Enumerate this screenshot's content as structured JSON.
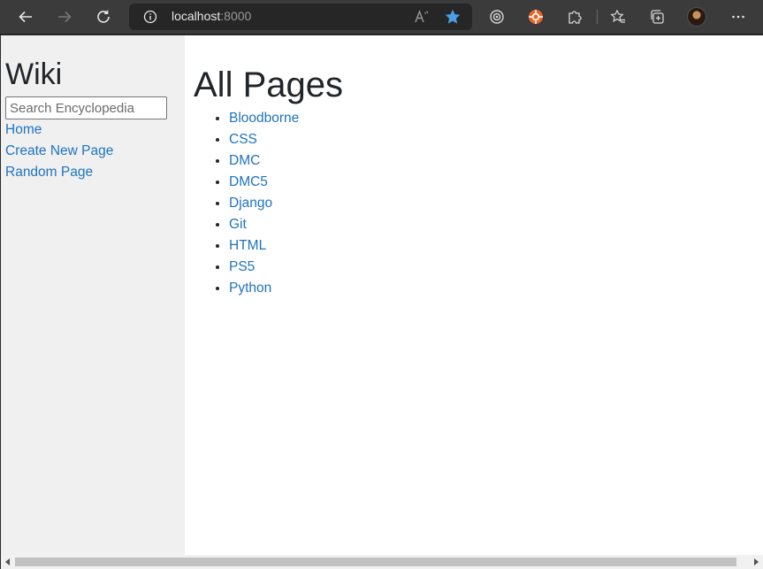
{
  "browser": {
    "url_host": "localhost",
    "url_port": ":8000",
    "icons": {
      "back": "back-arrow-icon",
      "forward": "forward-arrow-icon",
      "reload": "reload-icon",
      "info": "info-icon",
      "read_aloud": "read-aloud-icon",
      "favorite": "star-icon",
      "ext1": "tracking-icon",
      "ext2": "orange-extension-icon",
      "extensions": "puzzle-icon",
      "favorites": "favorites-icon",
      "collections": "collections-icon",
      "profile": "avatar",
      "menu": "more-icon"
    },
    "accent": "#4a9fe5"
  },
  "sidebar": {
    "title": "Wiki",
    "search_placeholder": "Search Encyclopedia",
    "links": [
      "Home",
      "Create New Page",
      "Random Page"
    ]
  },
  "main": {
    "heading": "All Pages",
    "pages": [
      "Bloodborne",
      "CSS",
      "DMC",
      "DMC5",
      "Django",
      "Git",
      "HTML",
      "PS5",
      "Python"
    ]
  },
  "colors": {
    "link": "#1e73be",
    "sidebar_bg": "#f0f0f0",
    "text": "#212529"
  }
}
